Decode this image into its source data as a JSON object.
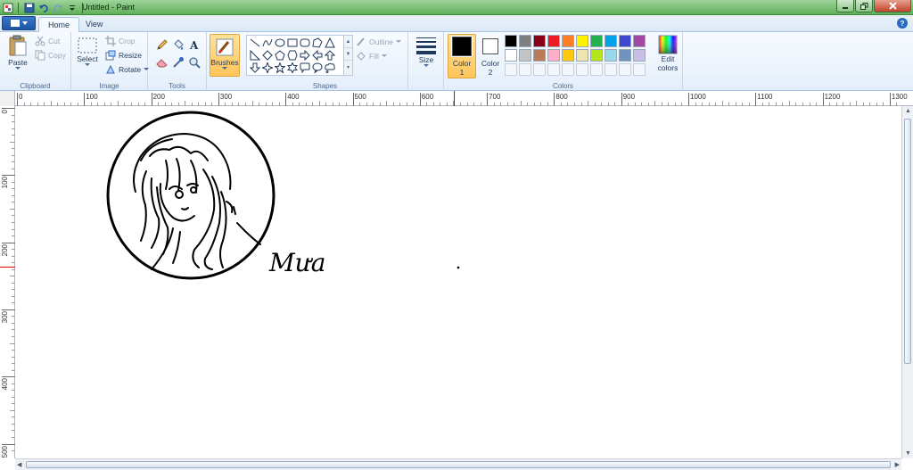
{
  "window": {
    "title": "Untitled - Paint"
  },
  "tabs": [
    {
      "label": "Home",
      "active": true
    },
    {
      "label": "View",
      "active": false
    }
  ],
  "ribbon": {
    "clipboard": {
      "group_label": "Clipboard",
      "paste": "Paste",
      "cut": "Cut",
      "copy": "Copy"
    },
    "image": {
      "group_label": "Image",
      "select": "Select",
      "crop": "Crop",
      "resize": "Resize",
      "rotate": "Rotate"
    },
    "tools": {
      "group_label": "Tools"
    },
    "brushes": {
      "label": "Brushes"
    },
    "shapes": {
      "group_label": "Shapes",
      "outline": "Outline",
      "fill": "Fill"
    },
    "size": {
      "label": "Size"
    },
    "colors": {
      "group_label": "Colors",
      "color1_label": "Color",
      "color1_num": "1",
      "color2_label": "Color",
      "color2_num": "2",
      "edit_label_1": "Edit",
      "edit_label_2": "colors",
      "color1": "#000000",
      "color2": "#ffffff",
      "palette_row1": [
        "#000000",
        "#7f7f7f",
        "#880015",
        "#ed1c24",
        "#ff7f27",
        "#fff200",
        "#22b14c",
        "#00a2e8",
        "#3f48cc",
        "#a349a4"
      ],
      "palette_row2": [
        "#ffffff",
        "#c3c3c3",
        "#b97a57",
        "#ffaec9",
        "#ffc90e",
        "#efe4b0",
        "#b5e61d",
        "#99d9ea",
        "#7092be",
        "#c8bfe7"
      ]
    }
  },
  "ruler": {
    "top_labels": [
      "0",
      "100",
      "200",
      "300",
      "400",
      "500",
      "600",
      "700",
      "800",
      "900",
      "1000",
      "1100",
      "1200",
      "1300"
    ],
    "left_labels": [
      "0",
      "100",
      "200",
      "300",
      "400",
      "500"
    ]
  },
  "canvas": {
    "signature": "Mưa"
  }
}
